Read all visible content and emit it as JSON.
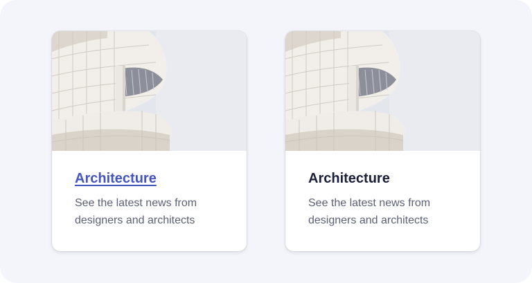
{
  "cards": [
    {
      "title": "Architecture",
      "description": "See the latest news from designers and architects",
      "state": "hover",
      "image": "architecture-building-photo"
    },
    {
      "title": "Architecture",
      "description": "See the latest news from designers and architects",
      "state": "default",
      "image": "architecture-building-photo"
    }
  ],
  "colors": {
    "background": "#f4f5fa",
    "card": "#ffffff",
    "title": "#1b1f3a",
    "title_link": "#4453c2",
    "description": "#5c6076"
  }
}
